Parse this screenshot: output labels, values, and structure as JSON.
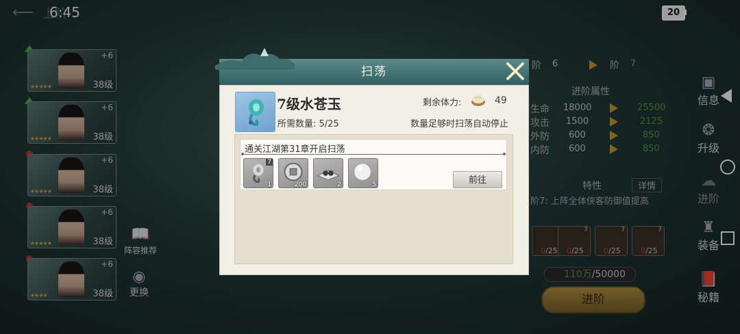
{
  "status": {
    "time": "6:45",
    "battery": "20"
  },
  "background": {
    "back_text": "上阶",
    "heroes": [
      {
        "plus": "+6",
        "level": "38级"
      },
      {
        "plus": "+6",
        "level": "38级"
      },
      {
        "plus": "+6",
        "level": "38级"
      },
      {
        "plus": "+6",
        "level": "38级"
      },
      {
        "plus": "+6",
        "level": "38级"
      }
    ],
    "lineup_recommend": "阵容推荐",
    "swap": "更换",
    "rank_from_label": "阶",
    "rank_from": "6",
    "rank_to_label": "阶",
    "rank_to": "7",
    "advance_attr_title": "进阶属性",
    "attrs": [
      {
        "name": "生命",
        "from": "18000",
        "to": "25500"
      },
      {
        "name": "攻击",
        "from": "1500",
        "to": "2125"
      },
      {
        "name": "外防",
        "from": "600",
        "to": "850"
      },
      {
        "name": "内防",
        "from": "600",
        "to": "850"
      }
    ],
    "trait_title": "特性",
    "trait_detail": "详情",
    "trait_text": "阶7: 上阵全体侠客防御值提高",
    "equip_slots": [
      {
        "count": "7",
        "owned": "0",
        "need": "/25"
      },
      {
        "count": "7",
        "owned": "0",
        "need": "/25"
      },
      {
        "count": "7",
        "owned": "0",
        "need": "/25"
      },
      {
        "count": "7",
        "owned": "0",
        "need": "/25"
      }
    ],
    "silver_have": "110万",
    "silver_need": "/50000",
    "advance_button": "进阶",
    "side_menu": [
      "信息",
      "升级",
      "进阶",
      "装备",
      "秘籍"
    ]
  },
  "dialog": {
    "title": "扫荡",
    "item_name": "7级水苍玉",
    "required_label": "所需数量:",
    "required_value": "5/25",
    "stamina_label": "剩余体力:",
    "stamina_value": "49",
    "auto_stop_text": "数量足够时扫荡自动停止",
    "stage_text": "通关江湖第31章开启扫荡",
    "rewards": [
      {
        "icon": "jade-pendant-icon",
        "level": "7",
        "count": "1"
      },
      {
        "icon": "coin-icon",
        "level": "",
        "count": "200"
      },
      {
        "icon": "pills-icon",
        "level": "",
        "count": "2"
      },
      {
        "icon": "pearl-icon",
        "level": "",
        "count": "5"
      }
    ],
    "goto_button": "前往"
  },
  "colors": {
    "header_teal": "#2f5f60",
    "body_cream": "#f2efe6",
    "item_blue": "#6ea2cf",
    "gold": "#c89a35",
    "green": "#4d9e3b"
  }
}
